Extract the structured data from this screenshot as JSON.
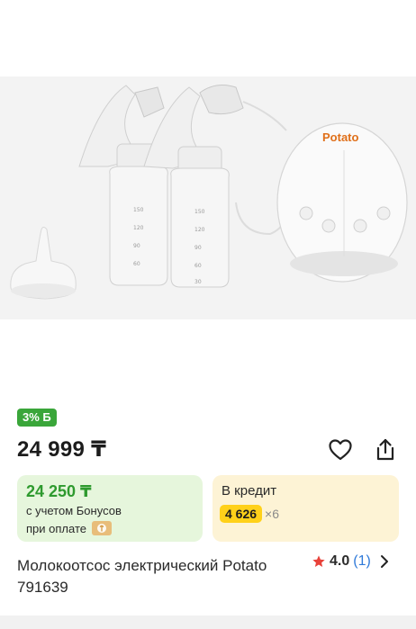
{
  "product_image": {
    "alt": "Potato breast pump set",
    "brand_on_device": "Potato",
    "bottle_marks": [
      "150",
      "120",
      "90",
      "60",
      "30"
    ]
  },
  "badge": {
    "label": "3% Б"
  },
  "price": {
    "value": "24 999 ₸"
  },
  "actions": {
    "favorite_icon": "heart-icon",
    "share_icon": "share-icon"
  },
  "bonus_card": {
    "price": "24 250 ₸",
    "line1": "с учетом Бонусов",
    "line2": "при оплате"
  },
  "credit_card": {
    "title": "В кредит",
    "amount": "4 626",
    "multiplier": "×6"
  },
  "product": {
    "title": "Молокоотсос электрический Potato 791639"
  },
  "rating": {
    "value": "4.0",
    "count": "(1)"
  },
  "colors": {
    "green": "#3aa63a",
    "bonus_bg": "#e6f6dc",
    "credit_bg": "#fdf3d5",
    "credit_highlight": "#ffd11a",
    "link_blue": "#2f7ad9",
    "brand_orange": "#e0701a",
    "star_red": "#e8423a"
  }
}
